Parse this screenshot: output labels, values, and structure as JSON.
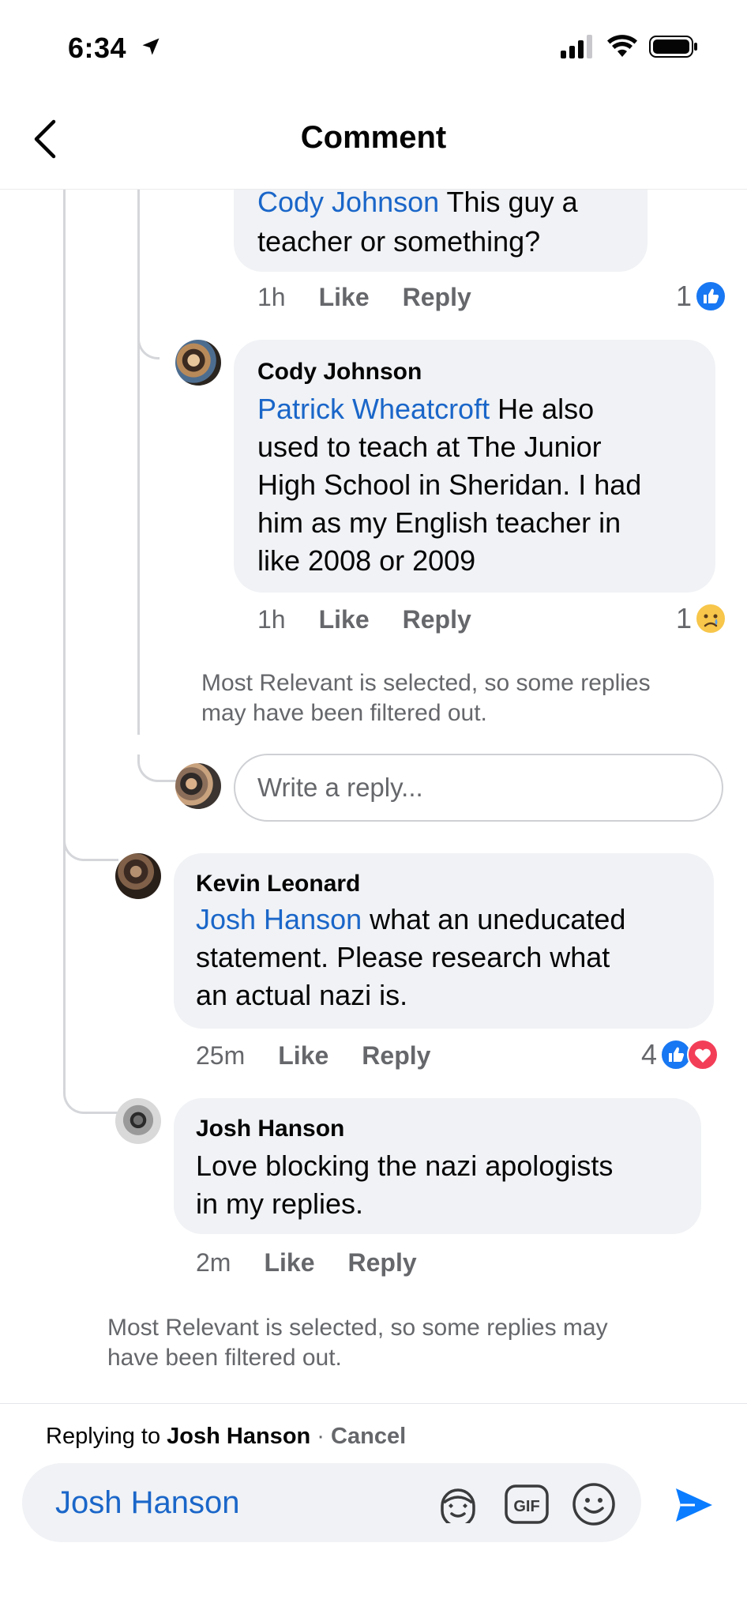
{
  "status": {
    "time": "6:34"
  },
  "header": {
    "title": "Comment"
  },
  "comments": [
    {
      "mention": "Cody Johnson",
      "text_line1": "This guy a",
      "text_line2": "teacher or something?",
      "time": "1h",
      "like": "Like",
      "reply": "Reply",
      "count": "1"
    },
    {
      "author": "Cody Johnson",
      "mention": "Patrick Wheatcroft",
      "text_line1": "He also",
      "text_line2": "used to teach at The Junior",
      "text_line3": "High School in Sheridan. I had",
      "text_line4": "him as my English teacher in",
      "text_line5": "like 2008 or 2009",
      "time": "1h",
      "like": "Like",
      "reply": "Reply",
      "count": "1"
    },
    {
      "author": "Kevin Leonard",
      "mention": "Josh Hanson",
      "text_line1": "what an uneducated",
      "text_line2": "statement. Please research what",
      "text_line3": "an actual nazi is.",
      "time": "25m",
      "like": "Like",
      "reply": "Reply",
      "count": "4"
    },
    {
      "author": "Josh Hanson",
      "text_line1": "Love blocking the nazi apologists",
      "text_line2": "in my replies.",
      "time": "2m",
      "like": "Like",
      "reply": "Reply"
    }
  ],
  "notes": {
    "filtered_inner_1": "Most Relevant is selected, so some replies",
    "filtered_inner_2": "may have been filtered out.",
    "filtered_outer_1": "Most Relevant is selected, so some replies may",
    "filtered_outer_2": "have been filtered out."
  },
  "reply_box": {
    "placeholder": "Write a reply..."
  },
  "footer": {
    "replying_prefix": "Replying to",
    "replying_name": "Josh Hanson",
    "separator": " · ",
    "cancel": "Cancel",
    "composer_value": "Josh Hanson"
  },
  "colors": {
    "accent": "#1a66c9",
    "like_blue": "#1877f2",
    "love_red": "#f33e58",
    "send_blue": "#0a7cff"
  }
}
